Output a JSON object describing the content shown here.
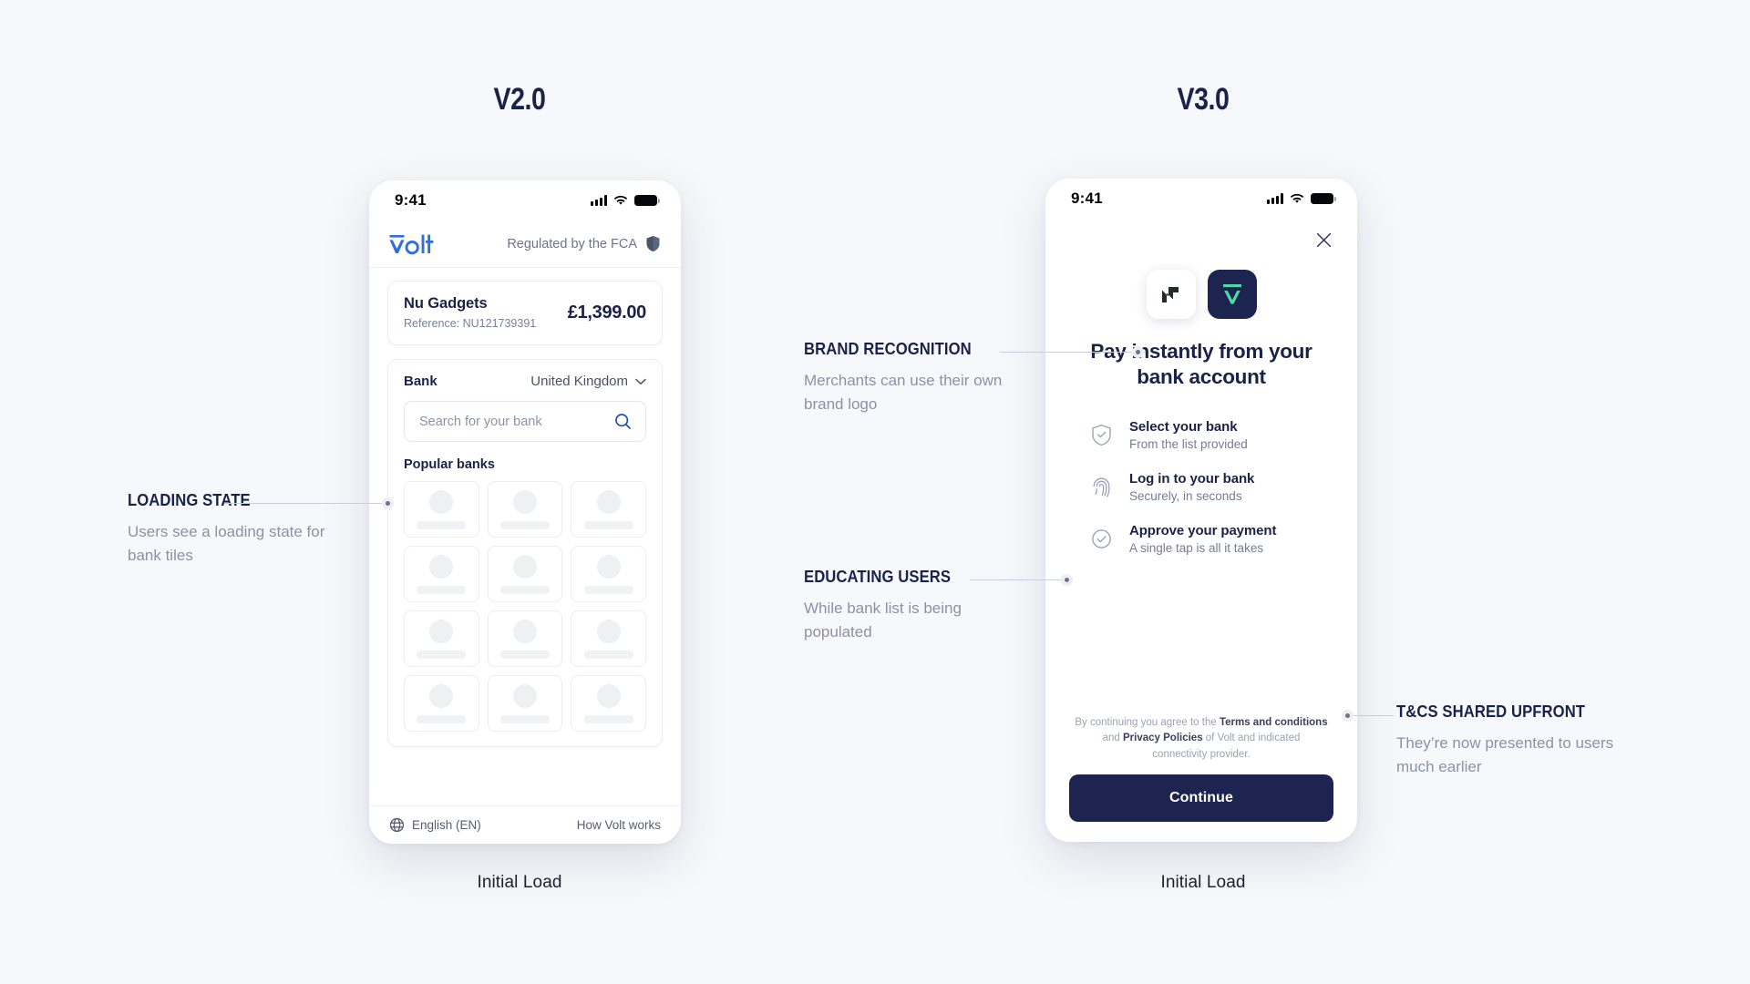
{
  "versions": {
    "left": {
      "title": "V2.0",
      "caption": "Initial Load"
    },
    "right": {
      "title": "V3.0",
      "caption": "Initial Load"
    }
  },
  "colors": {
    "page_background": "#f7f8fb",
    "navy": "#1b2248",
    "volt_blue": "#2f6fdc",
    "volt_mint": "#4fd9a4",
    "muted_text": "#8c92a4",
    "button": "#1e2450"
  },
  "v2": {
    "status_bar": {
      "time": "9:41",
      "signal_icon": "signal-bars-icon",
      "wifi_icon": "wifi-icon",
      "battery_icon": "battery-icon"
    },
    "header": {
      "logo": "volt-logo",
      "regulator_text": "Regulated by the FCA",
      "shield_icon": "shield-icon"
    },
    "merchant": {
      "name": "Nu Gadgets",
      "reference": "Reference: NU121739391",
      "amount": "£1,399.00"
    },
    "bank_section": {
      "label": "Bank",
      "country": "United Kingdom",
      "chevron_icon": "chevron-down-icon",
      "search_placeholder": "Search for your bank",
      "search_value": "",
      "search_icon": "search-icon",
      "popular_label": "Popular banks",
      "tile_count": 12,
      "tiles_state": "loading-skeleton"
    },
    "footer": {
      "globe_icon": "globe-icon",
      "language": "English (EN)",
      "how_it_works": "How Volt works"
    }
  },
  "v3": {
    "status_bar": {
      "time": "9:41",
      "signal_icon": "signal-bars-icon",
      "wifi_icon": "wifi-icon",
      "battery_icon": "battery-icon"
    },
    "close_icon": "close-icon",
    "logos": {
      "merchant_logo": "nu-gadgets-logo",
      "provider_logo": "volt-logo-mark"
    },
    "headline": "Pay instantly from your bank account",
    "steps": [
      {
        "icon": "shield-check-icon",
        "title": "Select your bank",
        "subtitle": "From the list provided"
      },
      {
        "icon": "fingerprint-icon",
        "title": "Log in to your bank",
        "subtitle": "Securely, in seconds"
      },
      {
        "icon": "check-circle-icon",
        "title": "Approve your payment",
        "subtitle": "A single tap is all it takes"
      }
    ],
    "terms": {
      "part1": "By continuing you agree to the ",
      "link1": "Terms and conditions",
      "part2": " and ",
      "link2": "Privacy Policies",
      "part3": " of Volt and indicated connectivity provider."
    },
    "continue_label": "Continue"
  },
  "annotations": {
    "loading_state": {
      "title": "LOADING STATE",
      "body": "Users see a loading state for bank tiles"
    },
    "brand_recognition": {
      "title": "BRAND RECOGNITION",
      "body": "Merchants can use their own brand logo"
    },
    "educating_users": {
      "title": "EDUCATING USERS",
      "body": "While bank list is being populated"
    },
    "tcs_shared": {
      "title": "T&CS SHARED UPFRONT",
      "body": "They’re now presented to users much earlier"
    }
  }
}
